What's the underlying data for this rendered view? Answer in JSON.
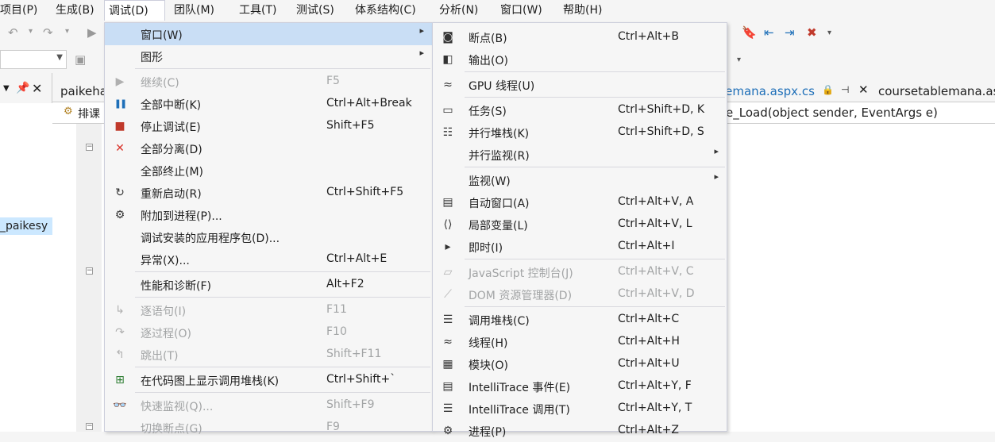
{
  "menubar": [
    "项目(P)",
    "生成(B)",
    "调试(D)",
    "团队(M)",
    "工具(T)",
    "测试(S)",
    "体系结构(C)",
    "分析(N)",
    "窗口(W)",
    "帮助(H)"
  ],
  "left_panel": {
    "solution_item": "_paikesy"
  },
  "tabs": {
    "left": "paikeha",
    "middle": "kemana.aspx.cs",
    "right": "coursetablemana.asp"
  },
  "nav": {
    "class_combo": "排课",
    "method_combo": "e_Load(object sender, EventArgs e)"
  },
  "debug_menu": [
    {
      "label": "窗口(W)",
      "shortcut": "",
      "icon": "",
      "submenu": true,
      "disabled": false,
      "highlight": true
    },
    {
      "label": "图形",
      "shortcut": "",
      "icon": "",
      "submenu": true,
      "disabled": false
    },
    {
      "sep": true
    },
    {
      "label": "继续(C)",
      "shortcut": "F5",
      "icon": "continue-icon",
      "disabled": true
    },
    {
      "label": "全部中断(K)",
      "shortcut": "Ctrl+Alt+Break",
      "icon": "pause-icon",
      "disabled": false
    },
    {
      "label": "停止调试(E)",
      "shortcut": "Shift+F5",
      "icon": "stop-icon",
      "disabled": false
    },
    {
      "label": "全部分离(D)",
      "shortcut": "",
      "icon": "detach-icon",
      "disabled": false
    },
    {
      "label": "全部终止(M)",
      "shortcut": "",
      "icon": "",
      "disabled": false
    },
    {
      "label": "重新启动(R)",
      "shortcut": "Ctrl+Shift+F5",
      "icon": "restart-icon",
      "disabled": false
    },
    {
      "label": "附加到进程(P)...",
      "shortcut": "",
      "icon": "attach-icon",
      "disabled": false
    },
    {
      "label": "调试安装的应用程序包(D)...",
      "shortcut": "",
      "icon": "",
      "disabled": false
    },
    {
      "label": "异常(X)...",
      "shortcut": "Ctrl+Alt+E",
      "icon": "",
      "disabled": false
    },
    {
      "sep": true
    },
    {
      "label": "性能和诊断(F)",
      "shortcut": "Alt+F2",
      "icon": "",
      "disabled": false
    },
    {
      "sep": true
    },
    {
      "label": "逐语句(I)",
      "shortcut": "F11",
      "icon": "step-into-icon",
      "disabled": true
    },
    {
      "label": "逐过程(O)",
      "shortcut": "F10",
      "icon": "step-over-icon",
      "disabled": true
    },
    {
      "label": "跳出(T)",
      "shortcut": "Shift+F11",
      "icon": "step-out-icon",
      "disabled": true
    },
    {
      "sep": true
    },
    {
      "label": "在代码图上显示调用堆栈(K)",
      "shortcut": "Ctrl+Shift+`",
      "icon": "code-map-icon",
      "disabled": false
    },
    {
      "sep": true
    },
    {
      "label": "快速监视(Q)...",
      "shortcut": "Shift+F9",
      "icon": "quick-watch-icon",
      "disabled": true
    },
    {
      "label": "切换断点(G)",
      "shortcut": "F9",
      "icon": "",
      "disabled": true
    }
  ],
  "window_submenu": [
    {
      "label": "断点(B)",
      "shortcut": "Ctrl+Alt+B",
      "icon": "breakpoints-icon",
      "disabled": false
    },
    {
      "label": "输出(O)",
      "shortcut": "",
      "icon": "output-icon",
      "disabled": false
    },
    {
      "sep": true
    },
    {
      "label": "GPU 线程(U)",
      "shortcut": "",
      "icon": "gpu-threads-icon",
      "disabled": false
    },
    {
      "sep": true
    },
    {
      "label": "任务(S)",
      "shortcut": "Ctrl+Shift+D, K",
      "icon": "tasks-icon",
      "disabled": false
    },
    {
      "label": "并行堆栈(K)",
      "shortcut": "Ctrl+Shift+D, S",
      "icon": "parallel-stacks-icon",
      "disabled": false
    },
    {
      "label": "并行监视(R)",
      "shortcut": "",
      "icon": "",
      "submenu": true,
      "disabled": false
    },
    {
      "sep": true
    },
    {
      "label": "监视(W)",
      "shortcut": "",
      "icon": "",
      "submenu": true,
      "disabled": false
    },
    {
      "label": "自动窗口(A)",
      "shortcut": "Ctrl+Alt+V, A",
      "icon": "autos-icon",
      "disabled": false
    },
    {
      "label": "局部变量(L)",
      "shortcut": "Ctrl+Alt+V, L",
      "icon": "locals-icon",
      "disabled": false
    },
    {
      "label": "即时(I)",
      "shortcut": "Ctrl+Alt+I",
      "icon": "immediate-icon",
      "disabled": false
    },
    {
      "sep": true
    },
    {
      "label": "JavaScript 控制台(J)",
      "shortcut": "Ctrl+Alt+V, C",
      "icon": "js-console-icon",
      "disabled": true
    },
    {
      "label": "DOM 资源管理器(D)",
      "shortcut": "Ctrl+Alt+V, D",
      "icon": "dom-explorer-icon",
      "disabled": true
    },
    {
      "sep": true
    },
    {
      "label": "调用堆栈(C)",
      "shortcut": "Ctrl+Alt+C",
      "icon": "call-stack-icon",
      "disabled": false
    },
    {
      "label": "线程(H)",
      "shortcut": "Ctrl+Alt+H",
      "icon": "threads-icon",
      "disabled": false
    },
    {
      "label": "模块(O)",
      "shortcut": "Ctrl+Alt+U",
      "icon": "modules-icon",
      "disabled": false
    },
    {
      "label": "IntelliTrace 事件(E)",
      "shortcut": "Ctrl+Alt+Y, F",
      "icon": "intellitrace-events-icon",
      "disabled": false
    },
    {
      "label": "IntelliTrace 调用(T)",
      "shortcut": "Ctrl+Alt+Y, T",
      "icon": "intellitrace-calls-icon",
      "disabled": false
    },
    {
      "label": "进程(P)",
      "shortcut": "Ctrl+Alt+Z",
      "icon": "processes-icon",
      "disabled": false
    }
  ],
  "colors": {
    "highlight": "#c9def5",
    "menu_bg": "#f6f6f6",
    "disabled": "#a2a4a5",
    "pause": "#1e6fb8",
    "stop": "#c0392b",
    "detach": "#d9342b"
  }
}
